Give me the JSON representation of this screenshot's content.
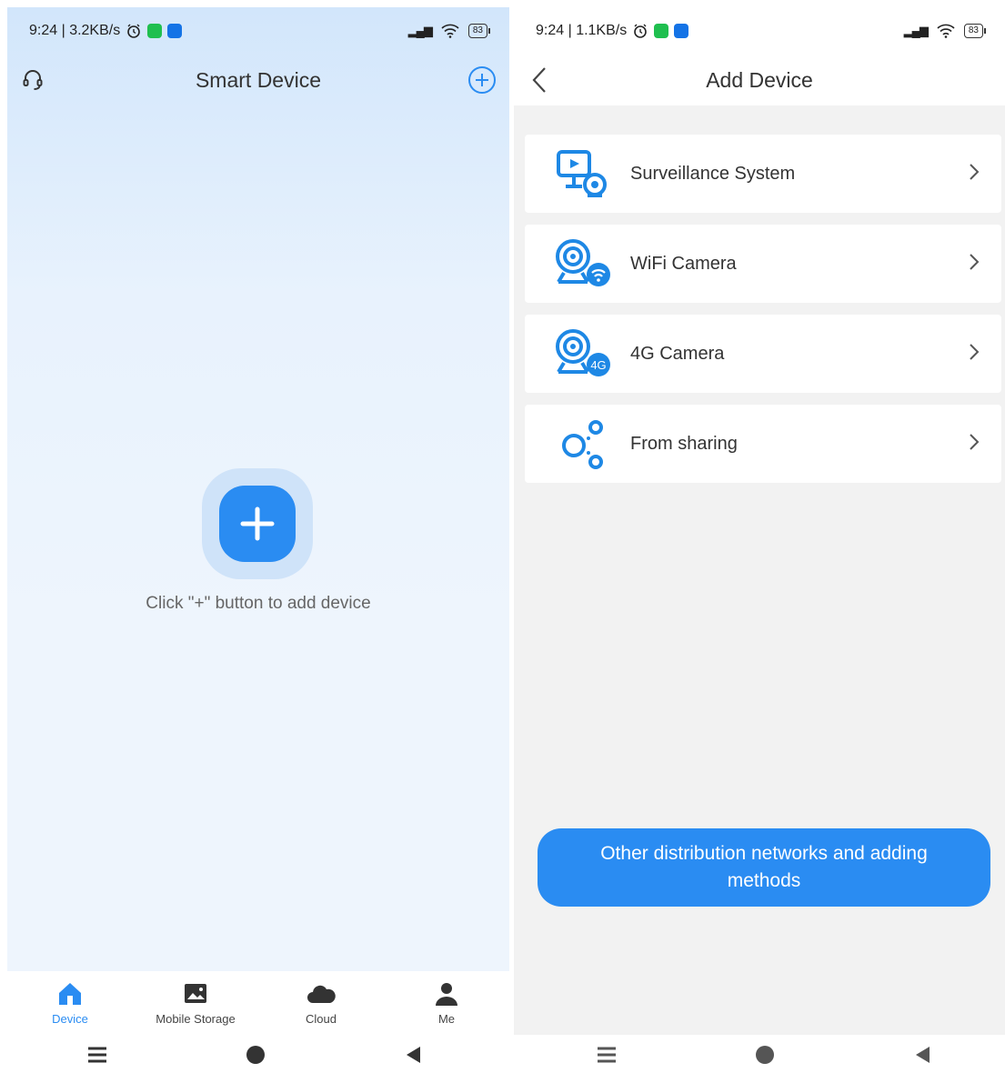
{
  "left_screen": {
    "status": {
      "time_speed": "9:24 | 3.2KB/s",
      "battery": "83"
    },
    "title": "Smart Device",
    "hint": "Click \"+\" button to add device",
    "tabs": [
      {
        "label": "Device",
        "icon": "home-icon",
        "active": true
      },
      {
        "label": "Mobile Storage",
        "icon": "image-icon",
        "active": false
      },
      {
        "label": "Cloud",
        "icon": "cloud-icon",
        "active": false
      },
      {
        "label": "Me",
        "icon": "person-icon",
        "active": false
      }
    ]
  },
  "right_screen": {
    "status": {
      "time_speed": "9:24 | 1.1KB/s",
      "battery": "83"
    },
    "title": "Add Device",
    "items": [
      {
        "label": "Surveillance System",
        "icon": "surveillance-system-icon"
      },
      {
        "label": "WiFi Camera",
        "icon": "wifi-camera-icon"
      },
      {
        "label": "4G Camera",
        "icon": "4g-camera-icon",
        "badge": "4G"
      },
      {
        "label": "From sharing",
        "icon": "share-icon"
      }
    ],
    "other_button": "Other distribution networks and adding methods"
  },
  "colors": {
    "accent": "#2a8cf2",
    "icon_blue": "#1e88e5",
    "annotation_arrow": "#d32f2f"
  }
}
